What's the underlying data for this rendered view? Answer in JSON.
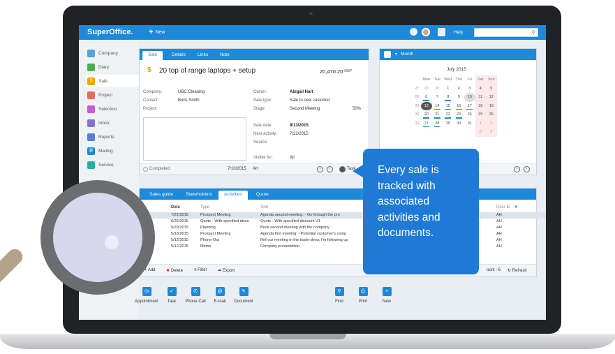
{
  "app": {
    "logo": "SuperOffice.",
    "new_label": "New",
    "help_label": "Help",
    "search_placeholder": ""
  },
  "nav": {
    "items": [
      {
        "label": "Company",
        "icon": "company-icon",
        "color": "#5aa0d8"
      },
      {
        "label": "Diary",
        "icon": "diary-icon",
        "color": "#4caf50"
      },
      {
        "label": "Sale",
        "icon": "sale-icon",
        "color": "#f2a500"
      },
      {
        "label": "Project",
        "icon": "project-icon",
        "color": "#e86a5c"
      },
      {
        "label": "Selection",
        "icon": "selection-icon",
        "color": "#c05fd0"
      },
      {
        "label": "Inbox",
        "icon": "inbox-icon",
        "color": "#8a6fd8"
      },
      {
        "label": "Reports",
        "icon": "reports-icon",
        "color": "#5a7fd8"
      },
      {
        "label": "Mailing",
        "icon": "mailing-icon",
        "color": "#1c8ad8"
      },
      {
        "label": "Service",
        "icon": "service-icon",
        "color": "#2bb0a0"
      }
    ]
  },
  "sale": {
    "tabs": [
      "Sale",
      "Details",
      "Links",
      "Note"
    ],
    "title": "20 top of range laptops + setup",
    "amount": "20,470.20",
    "currency": "GBP",
    "company_label": "Company:",
    "company": "UBC Cleaning",
    "contact_label": "Contact:",
    "contact": "Boris Smith",
    "project_label": "Project:",
    "owner_label": "Owner:",
    "owner": "Abigail Hart",
    "sale_type_label": "Sale type:",
    "sale_type": "Sale to new customer",
    "stage_label": "Stage:",
    "stage": "Second Meeting",
    "stage_pct": "50%",
    "sale_date_label": "Sale date:",
    "sale_date": "8/13/2015",
    "next_activity_label": "Next activity:",
    "next_activity": "7/22/2015",
    "source_label": "Source:",
    "visible_for_label": "Visible for:",
    "visible_for": "All",
    "completed_label": "Completed",
    "footer_date": "7/10/2015",
    "footer_user": "AH",
    "task_label": "Task"
  },
  "calendar": {
    "view_label": "Month",
    "month": "July 2015",
    "weekdays": [
      "Mon",
      "Tue",
      "Wed",
      "Thu",
      "Fri",
      "Sat",
      "Sun"
    ],
    "weeks": [
      {
        "wk": "27",
        "days": [
          "29",
          "30",
          "1",
          "2",
          "3",
          "4",
          "5"
        ]
      },
      {
        "wk": "28",
        "days": [
          "6",
          "7",
          "8",
          "9",
          "10",
          "11",
          "12"
        ]
      },
      {
        "wk": "29",
        "days": [
          "13",
          "14",
          "15",
          "16",
          "17",
          "18",
          "19"
        ]
      },
      {
        "wk": "30",
        "days": [
          "20",
          "21",
          "22",
          "23",
          "24",
          "25",
          "26"
        ]
      },
      {
        "wk": "31",
        "days": [
          "27",
          "28",
          "29",
          "30",
          "31",
          "1",
          "2"
        ]
      },
      {
        "wk": "",
        "days": [
          "",
          "",
          "",
          "",
          "",
          "8",
          "9"
        ]
      }
    ]
  },
  "activities": {
    "tabs": [
      "Sales guide",
      "Stakeholders",
      "Activities",
      "Quote"
    ],
    "columns": {
      "date": "Date",
      "type": "Type",
      "text": "Text",
      "user": "User ID"
    },
    "rows": [
      {
        "date": "7/22/2015",
        "type": "Prospect Meeting",
        "text": "Agenda second meeting: - Go through the pro",
        "user": "AH"
      },
      {
        "date": "6/25/2015",
        "type": "Quote - With specified disco",
        "text": "Quote - With specified discount V1",
        "user": "AH"
      },
      {
        "date": "5/29/2015",
        "type": "Planning",
        "text": "Book second meeting with the company",
        "user": "AH"
      },
      {
        "date": "5/18/2015",
        "type": "Prospect Meeting",
        "text": "Agenda first meeting: - Potential customer's comp",
        "user": "AH"
      },
      {
        "date": "5/12/2015",
        "type": "Phone-Out",
        "text": "Ref our meeting in the trade-show, I'm following up",
        "user": "AH"
      },
      {
        "date": "5/12/2015",
        "type": "Memo",
        "text": "Company presentation",
        "user": "AH"
      }
    ],
    "add_label": "Add",
    "delete_label": "Delete",
    "filter_label": "Filter",
    "export_label": "Export",
    "count_label": "ount : 6",
    "refresh_label": "Refresh"
  },
  "toolbar": {
    "left": [
      "Appointment",
      "Task",
      "Phone Call",
      "E-mail",
      "Document"
    ],
    "right": [
      "Find",
      "Print",
      "New"
    ]
  },
  "callout": {
    "lines": [
      "Every sale is",
      "tracked with",
      "associated",
      "activities and",
      "documents."
    ]
  }
}
